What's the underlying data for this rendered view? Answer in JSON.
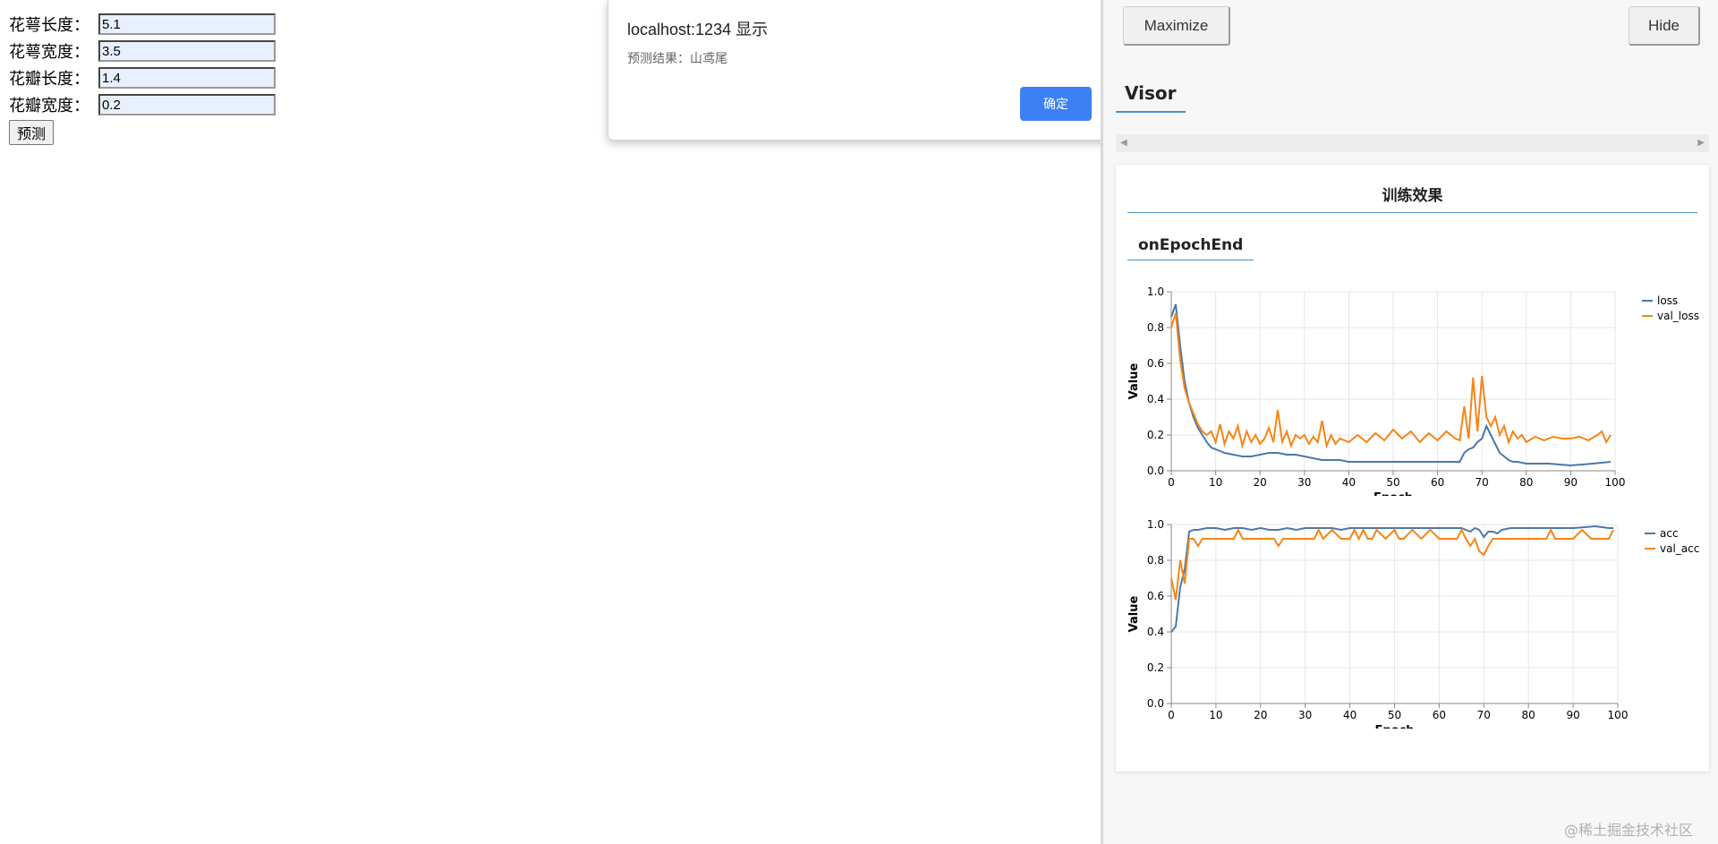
{
  "form": {
    "fields": [
      {
        "label": "花萼长度：",
        "value": "5.1"
      },
      {
        "label": "花萼宽度：",
        "value": "3.5"
      },
      {
        "label": "花瓣长度：",
        "value": "1.4"
      },
      {
        "label": "花瓣宽度：",
        "value": "0.2"
      }
    ],
    "predict_label": "预测"
  },
  "alert": {
    "title": "localhost:1234 显示",
    "message": "预测结果：山鸢尾",
    "ok_label": "确定"
  },
  "visor": {
    "maximize_label": "Maximize",
    "hide_label": "Hide",
    "title": "Visor",
    "card_title": "训练效果",
    "subtab": "onEpochEnd"
  },
  "watermark": "@稀土掘金技术社区",
  "colors": {
    "series1": "#4c78a8",
    "series2": "#f58518"
  },
  "chart_data": [
    {
      "type": "line",
      "xlabel": "Epoch",
      "ylabel": "Value",
      "xlim": [
        0,
        100
      ],
      "ylim": [
        0,
        1
      ],
      "xticks": [
        0,
        10,
        20,
        30,
        40,
        50,
        60,
        70,
        80,
        90,
        100
      ],
      "yticks": [
        0.0,
        0.2,
        0.4,
        0.6,
        0.8,
        1.0
      ],
      "legend": "right",
      "grid": true,
      "series": [
        {
          "name": "loss",
          "x": [
            0,
            1,
            2,
            3,
            4,
            5,
            6,
            7,
            8,
            9,
            10,
            11,
            12,
            14,
            16,
            18,
            20,
            22,
            24,
            26,
            28,
            30,
            32,
            34,
            36,
            38,
            40,
            45,
            50,
            55,
            60,
            63,
            65,
            66,
            67,
            68,
            69,
            70,
            71,
            72,
            73,
            74,
            75,
            76,
            77,
            78,
            80,
            85,
            90,
            95,
            99
          ],
          "values": [
            0.86,
            0.93,
            0.7,
            0.5,
            0.38,
            0.3,
            0.24,
            0.2,
            0.16,
            0.13,
            0.12,
            0.11,
            0.1,
            0.09,
            0.08,
            0.08,
            0.09,
            0.1,
            0.1,
            0.09,
            0.09,
            0.08,
            0.07,
            0.06,
            0.06,
            0.06,
            0.05,
            0.05,
            0.05,
            0.05,
            0.05,
            0.05,
            0.05,
            0.1,
            0.12,
            0.13,
            0.16,
            0.18,
            0.25,
            0.2,
            0.15,
            0.1,
            0.08,
            0.06,
            0.05,
            0.05,
            0.04,
            0.04,
            0.03,
            0.04,
            0.05
          ]
        },
        {
          "name": "val_loss",
          "x": [
            0,
            1,
            2,
            3,
            4,
            5,
            6,
            7,
            8,
            9,
            10,
            11,
            12,
            13,
            14,
            15,
            16,
            17,
            18,
            19,
            20,
            21,
            22,
            23,
            24,
            25,
            26,
            27,
            28,
            29,
            30,
            31,
            32,
            33,
            34,
            35,
            36,
            37,
            38,
            40,
            42,
            44,
            46,
            48,
            50,
            52,
            54,
            56,
            58,
            60,
            62,
            64,
            65,
            66,
            67,
            68,
            69,
            70,
            71,
            72,
            73,
            74,
            75,
            76,
            77,
            78,
            79,
            80,
            82,
            84,
            86,
            88,
            90,
            92,
            94,
            96,
            97,
            98,
            99
          ],
          "values": [
            0.8,
            0.88,
            0.62,
            0.46,
            0.38,
            0.32,
            0.26,
            0.22,
            0.2,
            0.22,
            0.16,
            0.26,
            0.15,
            0.22,
            0.18,
            0.25,
            0.14,
            0.22,
            0.16,
            0.2,
            0.15,
            0.18,
            0.24,
            0.16,
            0.34,
            0.16,
            0.22,
            0.14,
            0.2,
            0.18,
            0.2,
            0.15,
            0.19,
            0.16,
            0.28,
            0.14,
            0.2,
            0.15,
            0.18,
            0.16,
            0.2,
            0.16,
            0.21,
            0.17,
            0.23,
            0.18,
            0.22,
            0.16,
            0.21,
            0.17,
            0.22,
            0.18,
            0.17,
            0.36,
            0.18,
            0.52,
            0.22,
            0.53,
            0.3,
            0.25,
            0.3,
            0.2,
            0.25,
            0.16,
            0.22,
            0.18,
            0.2,
            0.16,
            0.19,
            0.17,
            0.19,
            0.18,
            0.18,
            0.19,
            0.17,
            0.2,
            0.22,
            0.16,
            0.2
          ]
        }
      ]
    },
    {
      "type": "line",
      "xlabel": "Epoch",
      "ylabel": "Value",
      "xlim": [
        0,
        100
      ],
      "ylim": [
        0,
        1
      ],
      "xticks": [
        0,
        10,
        20,
        30,
        40,
        50,
        60,
        70,
        80,
        90,
        100
      ],
      "yticks": [
        0.0,
        0.2,
        0.4,
        0.6,
        0.8,
        1.0
      ],
      "legend": "right",
      "grid": true,
      "series": [
        {
          "name": "acc",
          "x": [
            0,
            1,
            2,
            3,
            4,
            5,
            6,
            8,
            10,
            12,
            14,
            16,
            18,
            20,
            22,
            24,
            26,
            28,
            30,
            32,
            34,
            36,
            38,
            40,
            45,
            50,
            55,
            60,
            63,
            65,
            66,
            67,
            68,
            69,
            70,
            71,
            72,
            73,
            74,
            76,
            78,
            80,
            85,
            90,
            95,
            98,
            99
          ],
          "values": [
            0.4,
            0.43,
            0.65,
            0.75,
            0.96,
            0.97,
            0.97,
            0.98,
            0.98,
            0.97,
            0.98,
            0.98,
            0.97,
            0.98,
            0.97,
            0.97,
            0.98,
            0.97,
            0.98,
            0.98,
            0.98,
            0.98,
            0.97,
            0.98,
            0.98,
            0.98,
            0.98,
            0.98,
            0.98,
            0.98,
            0.97,
            0.96,
            0.98,
            0.97,
            0.93,
            0.96,
            0.96,
            0.95,
            0.97,
            0.98,
            0.98,
            0.98,
            0.98,
            0.98,
            0.99,
            0.98,
            0.98
          ]
        },
        {
          "name": "val_acc",
          "x": [
            0,
            1,
            2,
            3,
            4,
            5,
            6,
            7,
            8,
            10,
            14,
            15,
            16,
            20,
            23,
            24,
            25,
            30,
            32,
            33,
            34,
            36,
            38,
            40,
            41,
            42,
            43,
            44,
            45,
            46,
            48,
            50,
            51,
            52,
            54,
            56,
            58,
            60,
            62,
            64,
            65,
            66,
            67,
            68,
            69,
            70,
            71,
            72,
            73,
            74,
            75,
            76,
            78,
            80,
            82,
            84,
            85,
            86,
            88,
            90,
            92,
            94,
            96,
            98,
            99
          ],
          "values": [
            0.7,
            0.58,
            0.8,
            0.67,
            0.92,
            0.92,
            0.88,
            0.92,
            0.92,
            0.92,
            0.92,
            0.97,
            0.92,
            0.92,
            0.92,
            0.88,
            0.92,
            0.92,
            0.92,
            0.97,
            0.92,
            0.97,
            0.92,
            0.92,
            0.97,
            0.92,
            0.97,
            0.92,
            0.92,
            0.97,
            0.92,
            0.97,
            0.92,
            0.92,
            0.97,
            0.92,
            0.97,
            0.92,
            0.92,
            0.92,
            0.97,
            0.92,
            0.88,
            0.92,
            0.85,
            0.83,
            0.88,
            0.92,
            0.92,
            0.92,
            0.92,
            0.92,
            0.92,
            0.92,
            0.92,
            0.92,
            0.97,
            0.92,
            0.92,
            0.92,
            0.97,
            0.92,
            0.92,
            0.92,
            0.97
          ]
        }
      ]
    }
  ]
}
